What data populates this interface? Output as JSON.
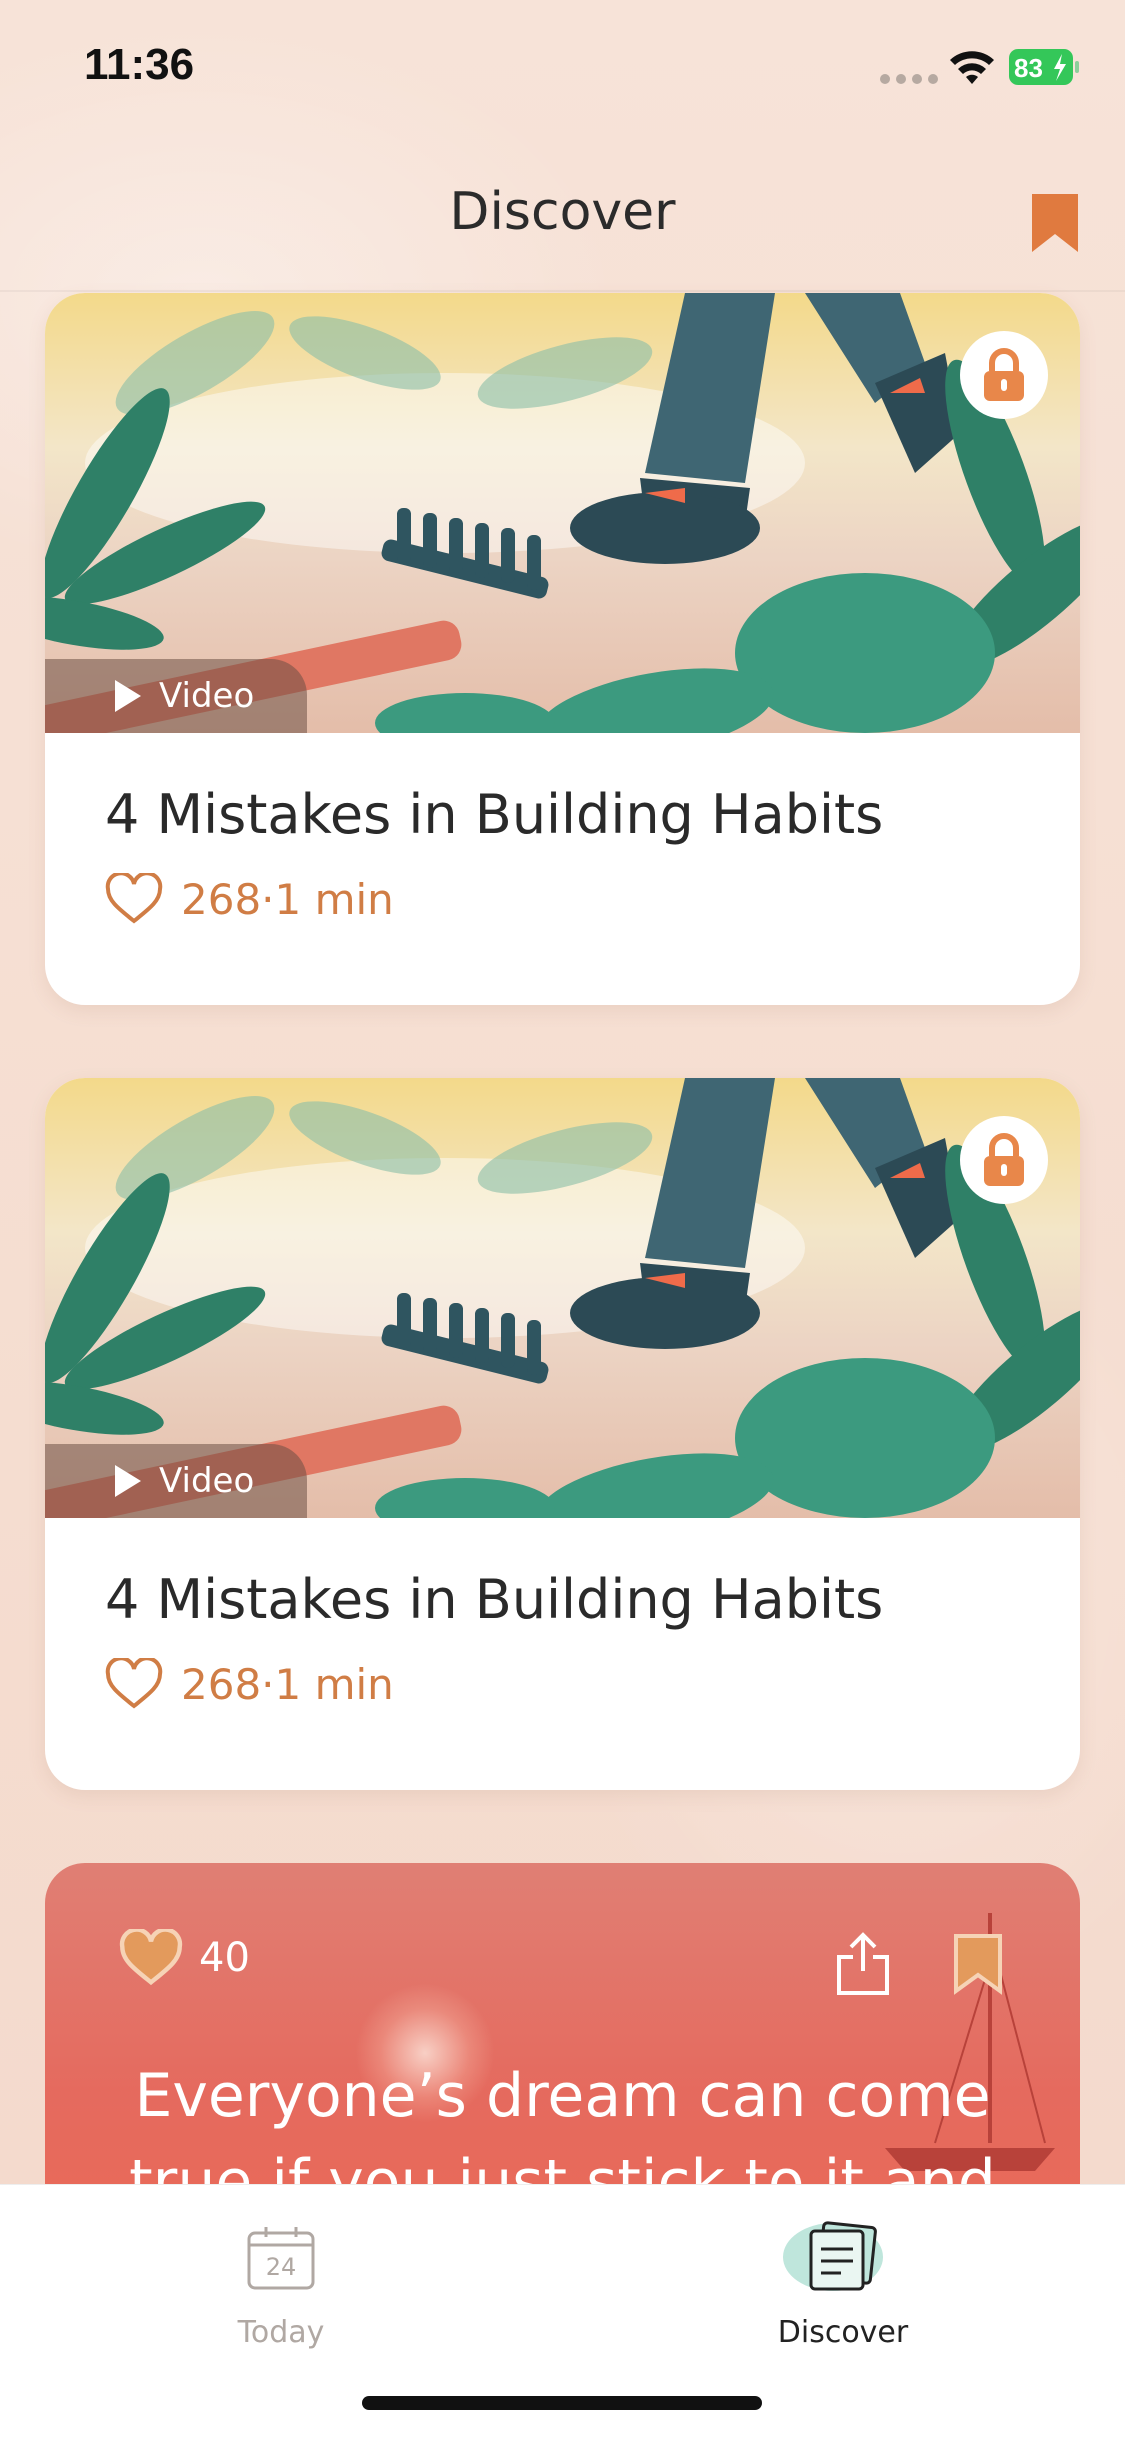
{
  "status_bar": {
    "time": "11:36",
    "battery_level": "83"
  },
  "header": {
    "title": "Discover"
  },
  "cards": [
    {
      "badge_label": "Video",
      "title": "4 Mistakes in Building Habits",
      "likes": "268",
      "duration": "·1 min"
    },
    {
      "badge_label": "Video",
      "title": "4 Mistakes in Building Habits",
      "likes": "268",
      "duration": "·1 min"
    }
  ],
  "quote_card": {
    "likes": "40",
    "text_line1": "Everyone’s dream can come",
    "text_line2": "true if you just stick to it and"
  },
  "tab_bar": {
    "today_label": "Today",
    "today_date": "24",
    "discover_label": "Discover"
  },
  "colors": {
    "accent": "#d07d45",
    "background": "#f6e1d6",
    "quote_bg": "#e56a5e",
    "battery_green": "#34c759"
  }
}
